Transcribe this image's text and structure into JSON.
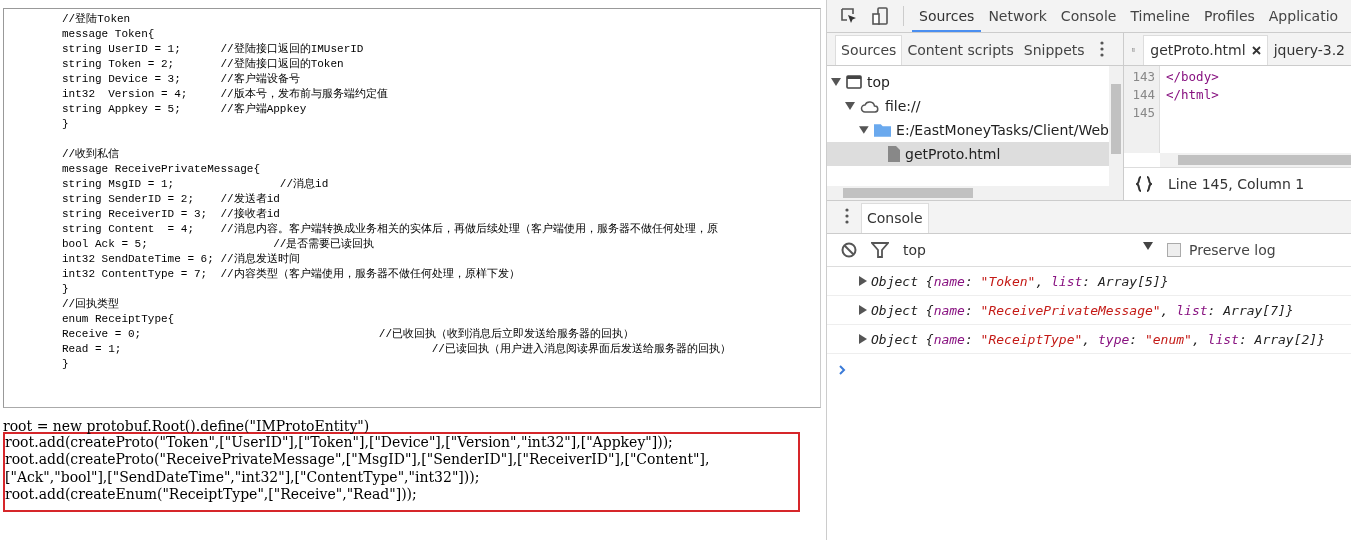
{
  "proto_source": {
    "blocks": [
      [
        "//登陆Token",
        "message Token{",
        "string UserID = 1;      //登陆接口返回的IMUserID",
        "string Token = 2;       //登陆接口返回的Token",
        "string Device = 3;      //客户端设备号",
        "int32  Version = 4;     //版本号，发布前与服务端约定值",
        "string Appkey = 5;      //客户端Appkey",
        "}"
      ],
      [
        "//收到私信",
        "message ReceivePrivateMessage{",
        "string MsgID = 1;                //消息id",
        "string SenderID = 2;    //发送者id",
        "string ReceiverID = 3;  //接收者id",
        "string Content  = 4;    //消息内容。客户端转换成业务相关的实体后，再做后续处理（客户端使用，服务器不做任何处理，原",
        "bool Ack = 5;                   //是否需要已读回执",
        "int32 SendDateTime = 6; //消息发送时间",
        "int32 ContentType = 7;  //内容类型（客户端使用，服务器不做任何处理，原样下发）",
        "}",
        "//回执类型",
        "enum ReceiptType{",
        "Receive = 0;                                    //已收回执（收到消息后立即发送给服务器的回执）",
        "Read = 1;                                               //已读回执（用户进入消息阅读界面后发送给服务器的回执）",
        "}"
      ]
    ]
  },
  "script_text": {
    "lines": [
      "root = new protobuf.Root().define(\"IMProtoEntity\")"
    ]
  },
  "highlighted_script": {
    "lines": [
      "root.add(createProto(\"Token\",[\"UserID\"],[\"Token\"],[\"Device\"],[\"Version\",\"int32\"],[\"Appkey\"]));",
      "root.add(createProto(\"ReceivePrivateMessage\",[\"MsgID\"],[\"SenderID\"],[\"ReceiverID\"],[\"Content\"],",
      "[\"Ack\",\"bool\"],[\"SendDateTime\",\"int32\"],[\"ContentType\",\"int32\"]));",
      "root.add(createEnum(\"ReceiptType\",[\"Receive\",\"Read\"]));"
    ]
  },
  "devtools": {
    "tabs": [
      {
        "label": "Sources",
        "selected": true
      },
      {
        "label": "Network",
        "selected": false
      },
      {
        "label": "Console",
        "selected": false
      },
      {
        "label": "Timeline",
        "selected": false
      },
      {
        "label": "Profiles",
        "selected": false
      },
      {
        "label": "Applicatio",
        "selected": false
      }
    ],
    "navigator_tabs": [
      {
        "label": "Sources",
        "selected": true
      },
      {
        "label": "Content scripts",
        "selected": false
      },
      {
        "label": "Snippets",
        "selected": false
      }
    ],
    "tree": [
      {
        "label": "top",
        "kind": "frame",
        "expanded": true,
        "selected": false,
        "children": [
          {
            "label": "file://",
            "kind": "origin",
            "expanded": true,
            "selected": false,
            "children": [
              {
                "label": "E:/EastMoneyTasks/Client/Web",
                "kind": "folder",
                "expanded": true,
                "selected": false,
                "children": [
                  {
                    "label": "getProto.html",
                    "kind": "file",
                    "selected": true
                  }
                ]
              }
            ]
          }
        ]
      }
    ],
    "editor_tabs": [
      {
        "label": "getProto.html",
        "selected": true,
        "closable": true
      },
      {
        "label": "jquery-3.2",
        "selected": false,
        "closable": false
      }
    ],
    "editor_lines": [
      {
        "number": "143",
        "code": "</body>"
      },
      {
        "number": "144",
        "code": "</html>"
      },
      {
        "number": "145"
      }
    ],
    "status": "Line 145, Column 1",
    "drawer_tab": "Console",
    "console_context": "top",
    "preserve_log": {
      "label": "Preserve log",
      "checked": false
    },
    "console_messages": [
      [
        {
          "kind": "type",
          "text": "Object {"
        },
        {
          "kind": "key",
          "text": "name"
        },
        {
          "kind": "plain",
          "text": ": "
        },
        {
          "kind": "string",
          "text": "\"Token\""
        },
        {
          "kind": "plain",
          "text": ", "
        },
        {
          "kind": "key",
          "text": "list"
        },
        {
          "kind": "plain",
          "text": ": Array[5]}"
        }
      ],
      [
        {
          "kind": "type",
          "text": "Object {"
        },
        {
          "kind": "key",
          "text": "name"
        },
        {
          "kind": "plain",
          "text": ": "
        },
        {
          "kind": "string",
          "text": "\"ReceivePrivateMessage\""
        },
        {
          "kind": "plain",
          "text": ", "
        },
        {
          "kind": "key",
          "text": "list"
        },
        {
          "kind": "plain",
          "text": ": Array[7]}"
        }
      ],
      [
        {
          "kind": "type",
          "text": "Object {"
        },
        {
          "kind": "key",
          "text": "name"
        },
        {
          "kind": "plain",
          "text": ": "
        },
        {
          "kind": "string",
          "text": "\"ReceiptType\""
        },
        {
          "kind": "plain",
          "text": ", "
        },
        {
          "kind": "key",
          "text": "type"
        },
        {
          "kind": "plain",
          "text": ": "
        },
        {
          "kind": "string",
          "text": "\"enum\""
        },
        {
          "kind": "plain",
          "text": ", "
        },
        {
          "kind": "key",
          "text": "list"
        },
        {
          "kind": "plain",
          "text": ": Array[2]}"
        }
      ]
    ]
  }
}
